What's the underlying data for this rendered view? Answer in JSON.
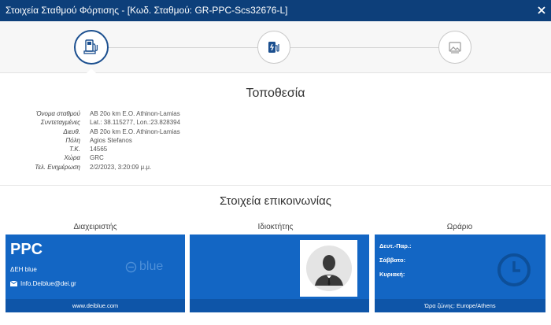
{
  "window": {
    "title": "Στοιχεία Σταθμού Φόρτισης - [Κωδ. Σταθμού: GR-PPC-Scs32676-L]"
  },
  "location": {
    "title": "Τοποθεσία",
    "rows": [
      {
        "label": "Όνομα σταθμού",
        "value": "AB 20o km  E.O. Athinon-Lamias"
      },
      {
        "label": "Συντεταγμένες",
        "value": "Lat.: 38.115277,  Lon.:23.828394"
      },
      {
        "label": "Διευθ.",
        "value": "AB 20o km  E.O. Athinon-Lamias"
      },
      {
        "label": "Πόλη",
        "value": "Agios Stefanos"
      },
      {
        "label": "Τ.Κ.",
        "value": "14565"
      },
      {
        "label": "Χώρα",
        "value": "GRC"
      },
      {
        "label": "Τελ. Ενημέρωση",
        "value": "2/2/2023, 3:20:09 μ.μ."
      }
    ]
  },
  "contact": {
    "title": "Στοιχεία επικοινωνίας",
    "operator": {
      "heading": "Διαχειριστής",
      "name": "PPC",
      "subname": "ΔΕΗ blue",
      "email": "Info.Deiblue@dei.gr",
      "logo_text": "blue",
      "website": "www.deiblue.com"
    },
    "owner": {
      "heading": "Ιδιοκτήτης"
    },
    "hours": {
      "heading": "Ωράριο",
      "weekdays": "Δευτ.-Παρ.:",
      "saturday": "Σάββατο:",
      "sunday": "Κυριακή:",
      "timezone": "Ώρα ζώνης: Europe/Athens"
    }
  },
  "colors": {
    "titlebar": "#0d3f7a",
    "card": "#1366c4",
    "card_footer": "#0e55a8"
  }
}
